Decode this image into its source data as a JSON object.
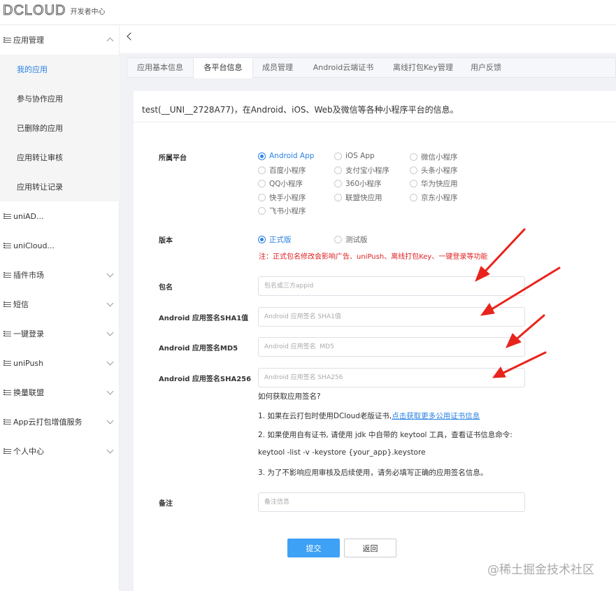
{
  "header": {
    "logo_text": "DCLOUD",
    "logo_sub": "开发者中心"
  },
  "sidebar": {
    "app_mgmt": "应用管理",
    "sub_items": [
      "我的应用",
      "参与协作应用",
      "已删除的应用",
      "应用转让审核",
      "应用转让记录"
    ],
    "items": [
      "uniAD...",
      "uniCloud...",
      "插件市场",
      "短信",
      "一键登录",
      "uniPush",
      "换量联盟",
      "App云打包增值服务",
      "个人中心"
    ]
  },
  "tabs": [
    "应用基本信息",
    "各平台信息",
    "成员管理",
    "Android云端证书",
    "离线打包Key管理",
    "用户反馈"
  ],
  "card": {
    "title": "test(__UNI__2728A77)，在Android、iOS、Web及微信等各种小程序平台的信息。"
  },
  "form": {
    "platform_label": "所属平台",
    "platforms": [
      "Android App",
      "iOS App",
      "微信小程序",
      "百度小程序",
      "支付宝小程序",
      "头条小程序",
      "QQ小程序",
      "360小程序",
      "华为快应用",
      "快手小程序",
      "联盟快应用",
      "京东小程序",
      "飞书小程序"
    ],
    "version_label": "版本",
    "versions": [
      "正式版",
      "测试版"
    ],
    "warning": "注：正式包名修改会影响广告、uniPush、离线打包Key、一键登录等功能",
    "package_label": "包名",
    "package_placeholder": "包名或三方appid",
    "sha1_label": "Android 应用签名SHA1值",
    "sha1_placeholder": "Android 应用签名 SHA1值",
    "md5_label": "Android 应用签名MD5",
    "md5_placeholder": "Android 应用签名  MD5",
    "sha256_label": "Android 应用签名SHA256",
    "sha256_placeholder": "Android 应用签名 SHA256",
    "help_title": "如何获取应用签名?",
    "help_1_prefix": "1. 如果在云打包时使用DCloud老版证书,",
    "help_1_link": "点击获取更多公用证书信息",
    "help_2": "2. 如果使用自有证书, 请使用 jdk 中自带的 keytool 工具，查看证书信息命令:",
    "help_cmd": "keytool -list -v -keystore {your_app}.keystore",
    "help_3": "3. 为了不影响应用审核及后续使用，请务必填写正确的应用签名信息。",
    "remark_label": "备注",
    "remark_placeholder": "备注信息",
    "submit_label": "提交",
    "back_label": "返回"
  },
  "watermark": "@稀土掘金技术社区",
  "colors": {
    "accent": "#2b82e4",
    "warning": "#e02020",
    "arrow": "#e8241c",
    "primary_button": "#3da1f5"
  }
}
